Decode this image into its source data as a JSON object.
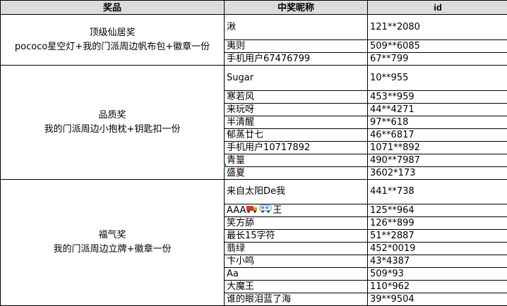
{
  "headers": {
    "prize": "奖品",
    "winner": "中奖昵称",
    "id": "id"
  },
  "groups": [
    {
      "prize_title": "顶级仙居奖",
      "prize_desc": "pococo星空灯+我的门派周边帆布包+徽章一份",
      "rows": [
        {
          "name": "湫",
          "id": "121**2080"
        },
        {
          "name": "夷则",
          "id": "509**6085"
        },
        {
          "name": "手机用户67476799",
          "id": "67**799"
        }
      ]
    },
    {
      "prize_title": "品质奖",
      "prize_desc": "我的门派周边小抱枕+钥匙扣一份",
      "rows": [
        {
          "name": "Sugar",
          "id": "10**955"
        },
        {
          "name": "寒若风",
          "id": "453**959"
        },
        {
          "name": "来玩呀",
          "id": "44**4271"
        },
        {
          "name": "半清醒",
          "id": "97**618"
        },
        {
          "name": "郁蒸廿七",
          "id": "46**6817"
        },
        {
          "name": "手机用户10717892",
          "id": "1071**892"
        },
        {
          "name": "青篁",
          "id": "490**7987"
        },
        {
          "name": "盛夏",
          "id": "3602*173"
        }
      ]
    },
    {
      "prize_title": "福气奖",
      "prize_desc": "我的门派周边立牌+徽章一份",
      "rows": [
        {
          "name": "来自太阳De我",
          "id": "441**738"
        },
        {
          "name_prefix": "AAA",
          "name_suffix": "王",
          "emoji_1": "truck-emoji",
          "emoji_2": "bus-emoji",
          "id": "125**964"
        },
        {
          "name": "笑方舔",
          "id": "126**899"
        },
        {
          "name": "最长15字符",
          "id": "51**2887"
        },
        {
          "name": "翡绿",
          "id": "452*0019"
        },
        {
          "name": "卞小鸣",
          "id": "43*4387"
        },
        {
          "name": "Aa",
          "id": "509*93"
        },
        {
          "name": "大魔王",
          "id": "110*962"
        },
        {
          "name": "谁的眼泪蓝了海",
          "id": "39**9504"
        }
      ]
    }
  ],
  "colors": {
    "header_bg": "#dcdcdc",
    "border": "#000000",
    "truck": "#e2332b",
    "bus": "#5b9bd5"
  }
}
